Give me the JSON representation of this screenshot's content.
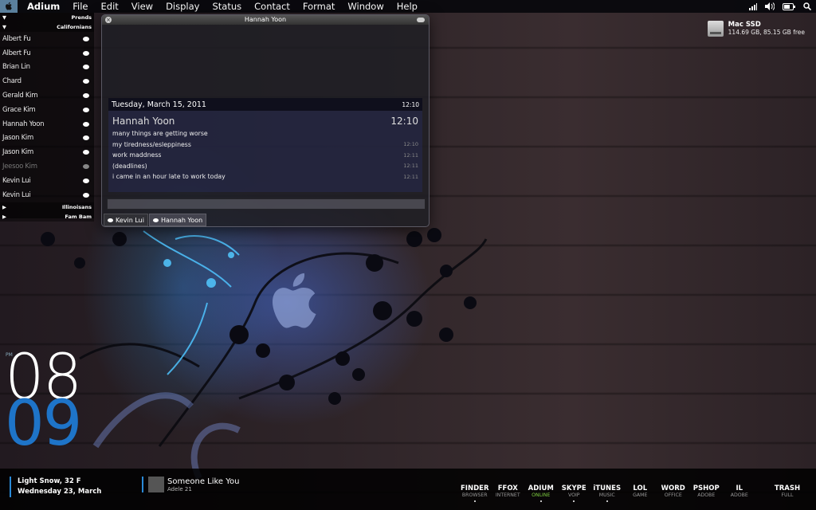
{
  "menubar": {
    "app": "Adium",
    "items": [
      "File",
      "Edit",
      "View",
      "Display",
      "Status",
      "Contact",
      "Format",
      "Window",
      "Help"
    ]
  },
  "drive": {
    "name": "Mac SSD",
    "info": "114.69 GB, 85.15 GB free"
  },
  "buddylist": {
    "groups_top": [
      "Prends",
      "Californians"
    ],
    "buddies": [
      {
        "name": "Albert Fu",
        "status": "active"
      },
      {
        "name": "Albert Fu",
        "status": "active"
      },
      {
        "name": "Brian  Lin",
        "status": "active"
      },
      {
        "name": "Chard",
        "status": "active"
      },
      {
        "name": "Gerald Kim",
        "status": "active"
      },
      {
        "name": "Grace Kim",
        "status": "active"
      },
      {
        "name": "Hannah Yoon",
        "status": "active"
      },
      {
        "name": "Jason Kim",
        "status": "active"
      },
      {
        "name": "Jason Kim",
        "status": "active"
      },
      {
        "name": "Jeesoo Kim",
        "status": "idle"
      },
      {
        "name": "Kevin Lui",
        "status": "active"
      },
      {
        "name": "Kevin Lui",
        "status": "active"
      }
    ],
    "groups_bottom": [
      "Illinoisans",
      "Fam Bam"
    ]
  },
  "chat": {
    "title": "Hannah Yoon",
    "date": "Tuesday, March 15, 2011",
    "date_time": "12:10",
    "sender": "Hannah Yoon",
    "sender_time": "12:10",
    "messages": [
      {
        "text": "many things are getting worse",
        "time": ""
      },
      {
        "text": "my tiredness/esleppiness",
        "time": "12:10"
      },
      {
        "text": "work maddness",
        "time": "12:11"
      },
      {
        "text": "(deadlines)",
        "time": "12:11"
      },
      {
        "text": "i came in an hour late to work today",
        "time": "12:11"
      }
    ],
    "tabs": [
      {
        "label": "Kevin Lui",
        "active": false
      },
      {
        "label": "Hannah Yoon",
        "active": true
      }
    ]
  },
  "clock": {
    "ampm": "PM",
    "hour": "08",
    "minute": "09"
  },
  "weather": {
    "line1": "Light Snow, 32 F",
    "line2": "Wednesday 23, March"
  },
  "music": {
    "song": "Someone Like You",
    "artist": "Adele 21"
  },
  "dock_apps": [
    {
      "name": "FINDER",
      "sub": "BROWSER",
      "running": true,
      "active": false
    },
    {
      "name": "FFOX",
      "sub": "INTERNET",
      "running": false,
      "active": false
    },
    {
      "name": "ADIUM",
      "sub": "ONLINE",
      "running": true,
      "active": true
    },
    {
      "name": "SKYPE",
      "sub": "VOIP",
      "running": true,
      "active": false
    },
    {
      "name": "iTUNES",
      "sub": "MUSIC",
      "running": true,
      "active": false
    },
    {
      "name": "LOL",
      "sub": "GAME",
      "running": false,
      "active": false
    },
    {
      "name": "WORD",
      "sub": "OFFICE",
      "running": false,
      "active": false
    },
    {
      "name": "PSHOP",
      "sub": "ADOBE",
      "running": false,
      "active": false
    },
    {
      "name": "IL",
      "sub": "ADOBE",
      "running": false,
      "active": false
    }
  ],
  "trash": {
    "name": "TRASH",
    "sub": "FULL"
  },
  "colors": {
    "accent": "#1e74c8",
    "online": "#7fd040"
  }
}
